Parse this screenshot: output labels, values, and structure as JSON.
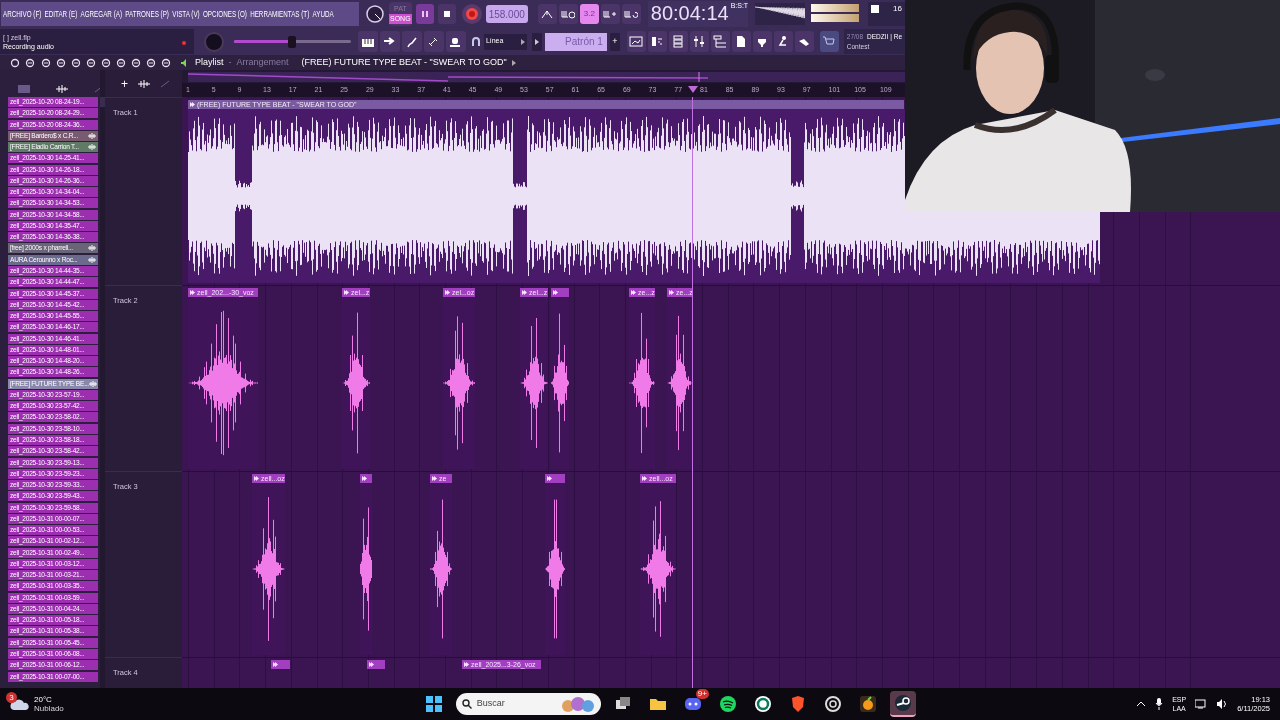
{
  "menu": [
    "ARCHIVO (F)",
    "EDITAR (E)",
    "AGREGAR (A)",
    "PATRONES (P)",
    "VISTA (V)",
    "OPCIONES (O)",
    "HERRAMIENTAS (T)",
    "AYUDA"
  ],
  "transport": {
    "pat_label": "PAT",
    "song_label": "SONG",
    "song_mode": true,
    "playing": true,
    "recording": true,
    "tempo": "158.000",
    "countdown": "3.2",
    "countdown_on": true,
    "time": "80:04:14",
    "time_unit": "B:S:T",
    "meter_value": "16"
  },
  "file": {
    "name": "[ ] zell.flp",
    "hint": "Recording audio"
  },
  "master": {
    "level": 0.5
  },
  "snap": "Línea",
  "pattern": "Patrón 1",
  "pattern_add": "+",
  "news": {
    "date": "27/08",
    "title": "DEDZII | Re",
    "subtitle": "Contest"
  },
  "playlist": {
    "title": "Playlist",
    "separator": "-",
    "mode": "Arrangement",
    "arrangement": "(FREE) FUTURE TYPE BEAT - \"SWEAR TO GOD\"",
    "add": "+"
  },
  "browser_items": [
    {
      "label": "zell_2025-10-20 08-24-19...",
      "kind": "audio",
      "color": "#9c2fb0"
    },
    {
      "label": "zell_2025-10-20 08-24-29...",
      "kind": "audio",
      "color": "#9c2fb0"
    },
    {
      "label": "zell_2025-10-20 08-24-36...",
      "kind": "audio",
      "color": "#9c2fb0"
    },
    {
      "label": "[FREE] Bardero$ x C.R...",
      "kind": "sample",
      "color": "#7a5a70"
    },
    {
      "label": "[FREE] Eladio Carrion T...",
      "kind": "sample",
      "color": "#5f7a66"
    },
    {
      "label": "zell_2025-10-30 14-25-41...",
      "kind": "audio",
      "color": "#9c2fb0"
    },
    {
      "label": "zell_2025-10-30 14-26-18...",
      "kind": "audio",
      "color": "#9c2fb0"
    },
    {
      "label": "zell_2025-10-30 14-26-36...",
      "kind": "audio",
      "color": "#9c2fb0"
    },
    {
      "label": "zell_2025-10-30 14-34-04...",
      "kind": "audio",
      "color": "#9c2fb0"
    },
    {
      "label": "zell_2025-10-30 14-34-53...",
      "kind": "audio",
      "color": "#9c2fb0"
    },
    {
      "label": "zell_2025-10-30 14-34-58...",
      "kind": "audio",
      "color": "#9c2fb0"
    },
    {
      "label": "zell_2025-10-30 14-35-47...",
      "kind": "audio",
      "color": "#9c2fb0"
    },
    {
      "label": "zell_2025-10-30 14-36-38...",
      "kind": "audio",
      "color": "#9c2fb0"
    },
    {
      "label": "[free] 2000s x pharrell...",
      "kind": "sample",
      "color": "#6a6478"
    },
    {
      "label": "AURA Cerounno x Roc...",
      "kind": "sample",
      "color": "#6b6a8c"
    },
    {
      "label": "zell_2025-10-30 14-44-35...",
      "kind": "audio",
      "color": "#9c2fb0"
    },
    {
      "label": "zell_2025-10-30 14-44-47...",
      "kind": "audio",
      "color": "#9c2fb0"
    },
    {
      "label": "zell_2025-10-30 14-45-37...",
      "kind": "audio",
      "color": "#9c2fb0"
    },
    {
      "label": "zell_2025-10-30 14-45-42...",
      "kind": "audio",
      "color": "#9c2fb0"
    },
    {
      "label": "zell_2025-10-30 14-45-55...",
      "kind": "audio",
      "color": "#9c2fb0"
    },
    {
      "label": "zell_2025-10-30 14-46-17...",
      "kind": "audio",
      "color": "#9c2fb0"
    },
    {
      "label": "zell_2025-10-30 14-46-41...",
      "kind": "audio",
      "color": "#9c2fb0"
    },
    {
      "label": "zell_2025-10-30 14-48-01...",
      "kind": "audio",
      "color": "#9c2fb0"
    },
    {
      "label": "zell_2025-10-30 14-48-20...",
      "kind": "audio",
      "color": "#9c2fb0"
    },
    {
      "label": "zell_2025-10-30 14-48-26...",
      "kind": "audio",
      "color": "#9c2fb0"
    },
    {
      "label": "[FREE] FUTURE TYPE BE...",
      "kind": "sample",
      "color": "#8a88aa"
    },
    {
      "label": "zell_2025-10-30 23-57-19...",
      "kind": "audio",
      "color": "#9c2fb0"
    },
    {
      "label": "zell_2025-10-30 23-57-42...",
      "kind": "audio",
      "color": "#9c2fb0"
    },
    {
      "label": "zell_2025-10-30 23-58-02...",
      "kind": "audio",
      "color": "#9c2fb0"
    },
    {
      "label": "zell_2025-10-30 23-58-10...",
      "kind": "audio",
      "color": "#9c2fb0"
    },
    {
      "label": "zell_2025-10-30 23-58-18...",
      "kind": "audio",
      "color": "#9c2fb0"
    },
    {
      "label": "zell_2025-10-30 23-58-42...",
      "kind": "audio",
      "color": "#9c2fb0"
    },
    {
      "label": "zell_2025-10-30 23-59-13...",
      "kind": "audio",
      "color": "#9c2fb0"
    },
    {
      "label": "zell_2025-10-30 23-59-23...",
      "kind": "audio",
      "color": "#9c2fb0"
    },
    {
      "label": "zell_2025-10-30 23-59-33...",
      "kind": "audio",
      "color": "#9c2fb0"
    },
    {
      "label": "zell_2025-10-30 23-59-43...",
      "kind": "audio",
      "color": "#9c2fb0"
    },
    {
      "label": "zell_2025-10-30 23-59-58...",
      "kind": "audio",
      "color": "#9c2fb0"
    },
    {
      "label": "zell_2025-10-31 00-00-07...",
      "kind": "audio",
      "color": "#9c2fb0"
    },
    {
      "label": "zell_2025-10-31 00-00-53...",
      "kind": "audio",
      "color": "#9c2fb0"
    },
    {
      "label": "zell_2025-10-31 00-02-12...",
      "kind": "audio",
      "color": "#9c2fb0"
    },
    {
      "label": "zell_2025-10-31 00-02-49...",
      "kind": "audio",
      "color": "#9c2fb0"
    },
    {
      "label": "zell_2025-10-31 00-03-12...",
      "kind": "audio",
      "color": "#9c2fb0"
    },
    {
      "label": "zell_2025-10-31 00-03-21...",
      "kind": "audio",
      "color": "#9c2fb0"
    },
    {
      "label": "zell_2025-10-31 00-03-35...",
      "kind": "audio",
      "color": "#9c2fb0"
    },
    {
      "label": "zell_2025-10-31 00-03-59...",
      "kind": "audio",
      "color": "#9c2fb0"
    },
    {
      "label": "zell_2025-10-31 00-04-24...",
      "kind": "audio",
      "color": "#9c2fb0"
    },
    {
      "label": "zell_2025-10-31 00-05-18...",
      "kind": "audio",
      "color": "#9c2fb0"
    },
    {
      "label": "zell_2025-10-31 00-05-38...",
      "kind": "audio",
      "color": "#9c2fb0"
    },
    {
      "label": "zell_2025-10-31 00-05-45...",
      "kind": "audio",
      "color": "#9c2fb0"
    },
    {
      "label": "zell_2025-10-31 00-06-08...",
      "kind": "audio",
      "color": "#9c2fb0"
    },
    {
      "label": "zell_2025-10-31 00-06-12...",
      "kind": "audio",
      "color": "#9c2fb0"
    },
    {
      "label": "zell_2025-10-31 00-07-00...",
      "kind": "audio",
      "color": "#9c2fb0"
    }
  ],
  "ruler": [
    "1",
    "5",
    "9",
    "13",
    "17",
    "21",
    "25",
    "29",
    "33",
    "37",
    "41",
    "45",
    "49",
    "53",
    "57",
    "61",
    "65",
    "69",
    "73",
    "77",
    "81",
    "85",
    "89",
    "93",
    "97",
    "101",
    "105",
    "109"
  ],
  "tracks": [
    {
      "name": "Track 1",
      "clips": [
        {
          "label": "(FREE) FUTURE TYPE BEAT - \"SWEAR TO GOD\"",
          "kind": "beat"
        }
      ]
    },
    {
      "name": "Track 2",
      "clips": [
        {
          "label": "zell_202...-30_voz",
          "kind": "voice"
        },
        {
          "label": "zel...z",
          "kind": "voice"
        },
        {
          "label": "zel...oz",
          "kind": "voice"
        },
        {
          "label": "zel...z",
          "kind": "voice"
        },
        {
          "kind": "voice"
        },
        {
          "label": "ze...z",
          "kind": "voice"
        },
        {
          "label": "ze...z",
          "kind": "voice"
        }
      ]
    },
    {
      "name": "Track 3",
      "clips": [
        {
          "label": "zell...oz",
          "kind": "voice"
        },
        {
          "kind": "voice"
        },
        {
          "label": "ze",
          "kind": "voice"
        },
        {
          "kind": "voice"
        },
        {
          "label": "zell...oz",
          "kind": "voice"
        }
      ]
    },
    {
      "name": "Track 4",
      "clips": [
        {
          "kind": "voice"
        },
        {
          "kind": "voice"
        },
        {
          "label": "zell_2025...3-26_voz",
          "kind": "voice"
        }
      ]
    }
  ],
  "taskbar": {
    "weather_badge": "3",
    "temperature": "20°C",
    "condition": "Nublado",
    "search": "Buscar",
    "apps": [
      {
        "kind": "start",
        "selected": false
      },
      {
        "kind": "taskview",
        "selected": false
      },
      {
        "kind": "explorer",
        "selected": false
      },
      {
        "kind": "discord",
        "badge": "9+",
        "selected": false
      },
      {
        "kind": "spotify",
        "selected": false
      },
      {
        "kind": "ring",
        "selected": false
      },
      {
        "kind": "brave",
        "selected": false
      },
      {
        "kind": "knot",
        "selected": false
      },
      {
        "kind": "fruit",
        "selected": false
      },
      {
        "kind": "steam",
        "selected": true
      }
    ],
    "language": "ESP",
    "layout": "LAA",
    "time": "19:13",
    "date": "6/11/2025"
  }
}
